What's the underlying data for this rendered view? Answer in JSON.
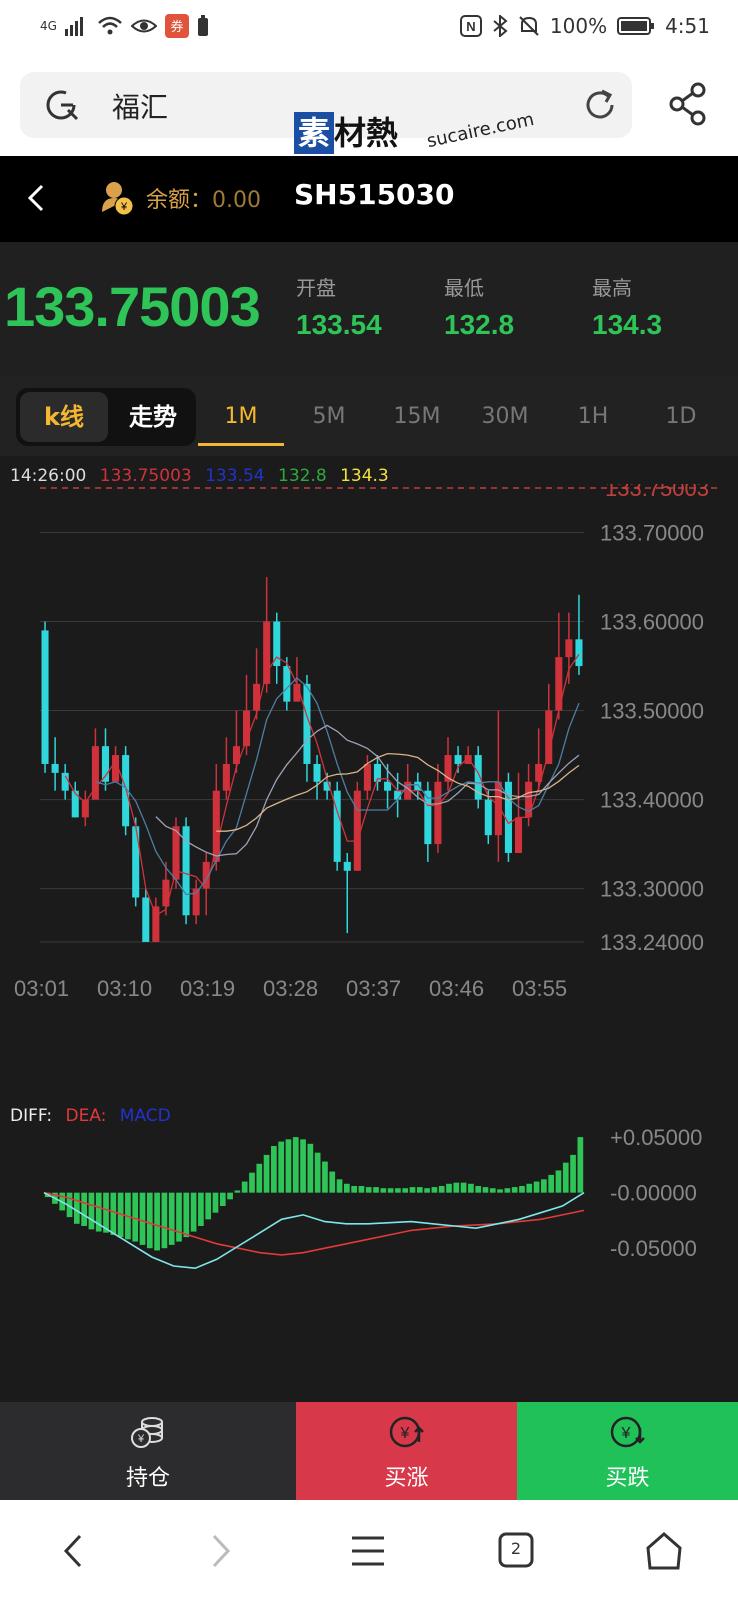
{
  "status_bar": {
    "network": "4G",
    "battery": "100%",
    "time": "4:51",
    "icons": [
      "signal-icon",
      "wifi-icon",
      "eye-icon",
      "app-icon",
      "battery-small-icon",
      "nfc-icon",
      "bluetooth-icon",
      "mute-icon",
      "battery-icon"
    ]
  },
  "browser": {
    "url_text": "福汇"
  },
  "watermark": {
    "brand_box": "素",
    "brand_rest": "材熱",
    "url": "sucaire.com"
  },
  "header": {
    "balance_label": "余额：",
    "balance_value": "0.00",
    "symbol": "SH515030"
  },
  "quote": {
    "last_price": "133.75003",
    "open_label": "开盘",
    "open_value": "133.54",
    "low_label": "最低",
    "low_value": "132.8",
    "high_label": "最高",
    "high_value": "134.3"
  },
  "tabs": {
    "kline_label": "k线",
    "trend_label": "走势",
    "timeframes": [
      "1M",
      "5M",
      "15M",
      "30M",
      "1H",
      "1D"
    ],
    "active_timeframe": "1M"
  },
  "chart_legend": {
    "time": "14:26:00",
    "last": "133.75003",
    "open": "133.54",
    "low": "132.8",
    "high": "134.3"
  },
  "macd_legend": {
    "diff": "DIFF:",
    "dea": "DEA:",
    "macd": "MACD"
  },
  "colors": {
    "up": "#d0323c",
    "down": "#2fd6dc",
    "green": "#2ec457",
    "gold": "#f5b731",
    "bg": "#1b1b1b"
  },
  "chart_data": [
    {
      "type": "candlestick",
      "title": "",
      "x_ticks": [
        "03:01",
        "03:10",
        "03:19",
        "03:28",
        "03:37",
        "03:46",
        "03:55"
      ],
      "y_ticks": [
        "133.70000",
        "133.60000",
        "133.50000",
        "133.40000",
        "133.30000",
        "133.24000"
      ],
      "price_line": "133.75003",
      "ylim": [
        133.24,
        133.75
      ],
      "candles": [
        [
          133.59,
          133.44,
          133.6,
          133.43
        ],
        [
          133.44,
          133.43,
          133.47,
          133.41
        ],
        [
          133.43,
          133.41,
          133.44,
          133.4
        ],
        [
          133.41,
          133.38,
          133.42,
          133.38
        ],
        [
          133.38,
          133.4,
          133.41,
          133.37
        ],
        [
          133.4,
          133.46,
          133.48,
          133.4
        ],
        [
          133.46,
          133.42,
          133.48,
          133.41
        ],
        [
          133.42,
          133.45,
          133.46,
          133.42
        ],
        [
          133.45,
          133.37,
          133.46,
          133.36
        ],
        [
          133.37,
          133.29,
          133.38,
          133.28
        ],
        [
          133.29,
          133.24,
          133.3,
          133.24
        ],
        [
          133.24,
          133.28,
          133.29,
          133.24
        ],
        [
          133.28,
          133.31,
          133.33,
          133.27
        ],
        [
          133.31,
          133.37,
          133.38,
          133.3
        ],
        [
          133.37,
          133.27,
          133.38,
          133.26
        ],
        [
          133.27,
          133.3,
          133.31,
          133.26
        ],
        [
          133.3,
          133.33,
          133.34,
          133.27
        ],
        [
          133.33,
          133.41,
          133.44,
          133.32
        ],
        [
          133.41,
          133.44,
          133.47,
          133.4
        ],
        [
          133.44,
          133.46,
          133.5,
          133.43
        ],
        [
          133.46,
          133.5,
          133.54,
          133.45
        ],
        [
          133.5,
          133.53,
          133.57,
          133.49
        ],
        [
          133.53,
          133.6,
          133.65,
          133.52
        ],
        [
          133.6,
          133.55,
          133.61,
          133.53
        ],
        [
          133.55,
          133.51,
          133.56,
          133.5
        ],
        [
          133.51,
          133.53,
          133.56,
          133.51
        ],
        [
          133.53,
          133.44,
          133.54,
          133.42
        ],
        [
          133.44,
          133.42,
          133.45,
          133.4
        ],
        [
          133.42,
          133.41,
          133.43,
          133.4
        ],
        [
          133.41,
          133.33,
          133.42,
          133.32
        ],
        [
          133.33,
          133.32,
          133.34,
          133.25
        ],
        [
          133.32,
          133.41,
          133.42,
          133.32
        ],
        [
          133.41,
          133.44,
          133.45,
          133.4
        ],
        [
          133.44,
          133.42,
          133.45,
          133.41
        ],
        [
          133.42,
          133.41,
          133.44,
          133.39
        ],
        [
          133.41,
          133.4,
          133.43,
          133.38
        ],
        [
          133.4,
          133.42,
          133.44,
          133.4
        ],
        [
          133.42,
          133.41,
          133.43,
          133.4
        ],
        [
          133.41,
          133.35,
          133.42,
          133.33
        ],
        [
          133.35,
          133.42,
          133.44,
          133.34
        ],
        [
          133.42,
          133.45,
          133.47,
          133.41
        ],
        [
          133.45,
          133.44,
          133.46,
          133.43
        ],
        [
          133.44,
          133.45,
          133.46,
          133.44
        ],
        [
          133.45,
          133.4,
          133.46,
          133.39
        ],
        [
          133.4,
          133.36,
          133.41,
          133.35
        ],
        [
          133.36,
          133.42,
          133.5,
          133.33
        ],
        [
          133.42,
          133.34,
          133.43,
          133.33
        ],
        [
          133.34,
          133.38,
          133.43,
          133.34
        ],
        [
          133.38,
          133.42,
          133.44,
          133.37
        ],
        [
          133.42,
          133.44,
          133.48,
          133.41
        ],
        [
          133.44,
          133.5,
          133.53,
          133.44
        ],
        [
          133.5,
          133.56,
          133.61,
          133.49
        ],
        [
          133.56,
          133.58,
          133.61,
          133.53
        ],
        [
          133.58,
          133.55,
          133.63,
          133.54
        ]
      ],
      "moving_averages": [
        "MA5",
        "MA10",
        "MA20",
        "MA30"
      ]
    },
    {
      "type": "bar",
      "title": "MACD",
      "y_ticks": [
        "+0.05000",
        "-0.00000",
        "-0.05000"
      ],
      "ylim": [
        -0.075,
        0.06
      ],
      "histogram": [
        -0.004,
        -0.01,
        -0.016,
        -0.022,
        -0.028,
        -0.03,
        -0.033,
        -0.035,
        -0.036,
        -0.038,
        -0.04,
        -0.042,
        -0.044,
        -0.047,
        -0.05,
        -0.052,
        -0.05,
        -0.047,
        -0.044,
        -0.04,
        -0.035,
        -0.03,
        -0.024,
        -0.018,
        -0.012,
        -0.006,
        0.002,
        0.01,
        0.018,
        0.026,
        0.034,
        0.042,
        0.046,
        0.048,
        0.05,
        0.048,
        0.044,
        0.036,
        0.028,
        0.019,
        0.012,
        0.008,
        0.006,
        0.006,
        0.005,
        0.005,
        0.004,
        0.004,
        0.004,
        0.004,
        0.005,
        0.005,
        0.004,
        0.005,
        0.006,
        0.008,
        0.009,
        0.009,
        0.008,
        0.006,
        0.005,
        0.004,
        0.003,
        0.004,
        0.005,
        0.006,
        0.008,
        0.01,
        0.012,
        0.016,
        0.02,
        0.027,
        0.034,
        0.05
      ],
      "diff": [
        0.0,
        -0.01,
        -0.022,
        -0.034,
        -0.046,
        -0.058,
        -0.066,
        -0.068,
        -0.06,
        -0.048,
        -0.036,
        -0.024,
        -0.02,
        -0.026,
        -0.028,
        -0.028,
        -0.027,
        -0.026,
        -0.028,
        -0.03,
        -0.032,
        -0.028,
        -0.024,
        -0.018,
        -0.012,
        0.0
      ],
      "dea": [
        0.0,
        -0.004,
        -0.01,
        -0.016,
        -0.022,
        -0.028,
        -0.034,
        -0.04,
        -0.046,
        -0.05,
        -0.054,
        -0.056,
        -0.054,
        -0.05,
        -0.046,
        -0.042,
        -0.038,
        -0.034,
        -0.032,
        -0.03,
        -0.029,
        -0.028,
        -0.026,
        -0.024,
        -0.02,
        -0.016
      ]
    }
  ],
  "bottom_actions": {
    "hold_label": "持仓",
    "buy_up_label": "买涨",
    "buy_down_label": "买跌"
  },
  "nav": {
    "tab_count": "2"
  }
}
